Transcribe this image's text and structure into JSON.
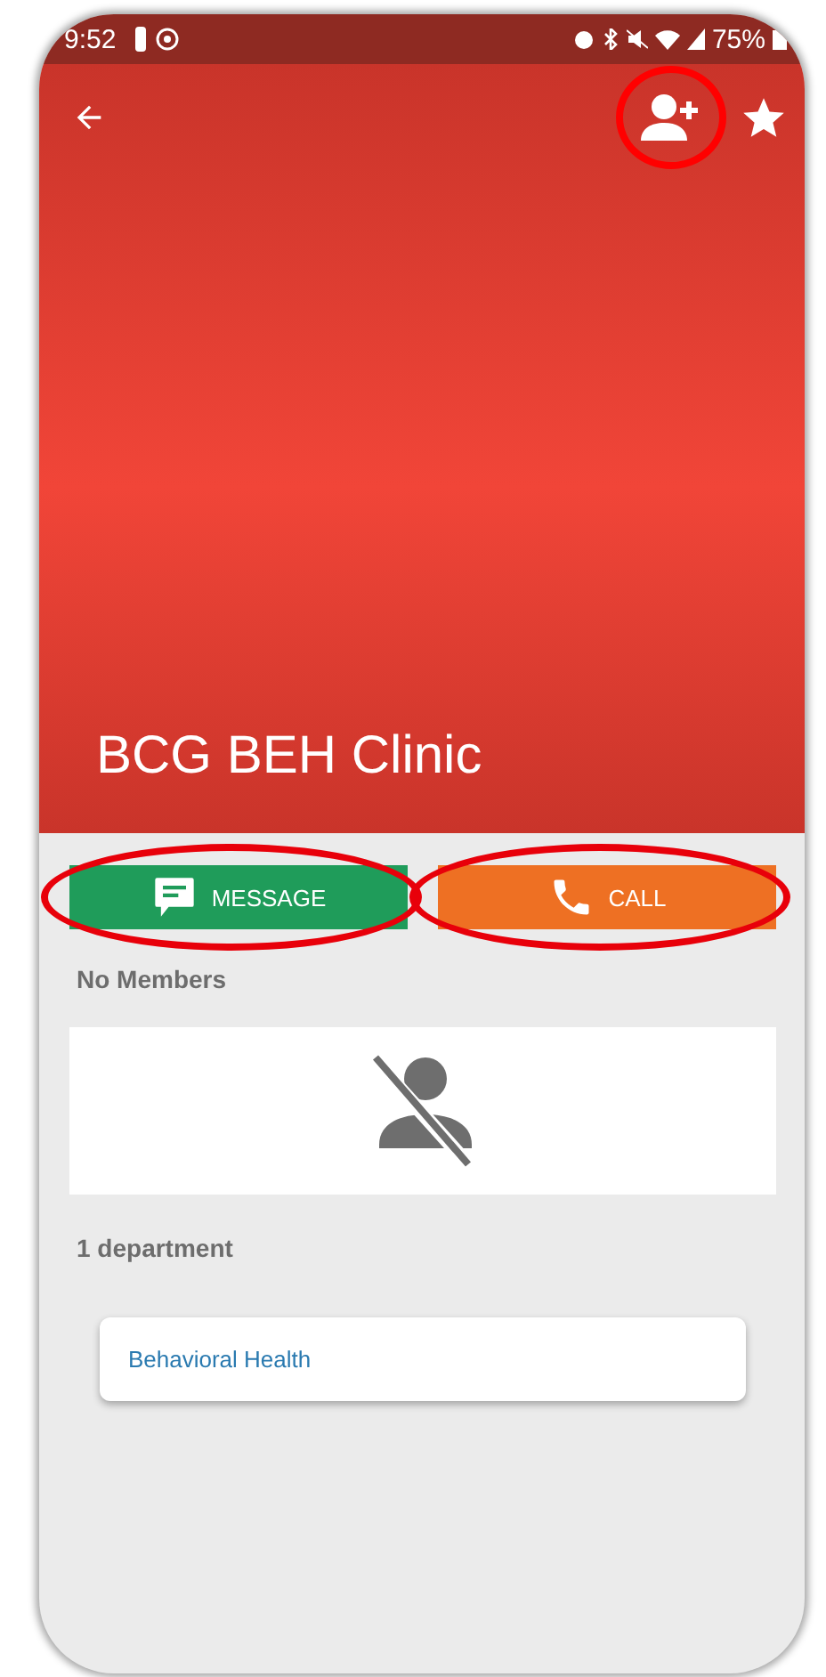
{
  "status_bar": {
    "time": "9:52",
    "battery": "75%"
  },
  "header": {
    "title": "BCG BEH Clinic",
    "actions": [
      {
        "kind": "add-member",
        "highlighted": true
      },
      {
        "kind": "favorite",
        "highlighted": false
      }
    ]
  },
  "buttons": [
    {
      "kind": "message",
      "label": "MESSAGE",
      "color": "#1f9c5a",
      "highlighted": true
    },
    {
      "kind": "call",
      "label": "CALL",
      "color": "#ee7023",
      "highlighted": true
    }
  ],
  "members": {
    "heading": "No Members"
  },
  "departments": {
    "heading": "1 department",
    "items": [
      "Behavioral Health"
    ]
  }
}
